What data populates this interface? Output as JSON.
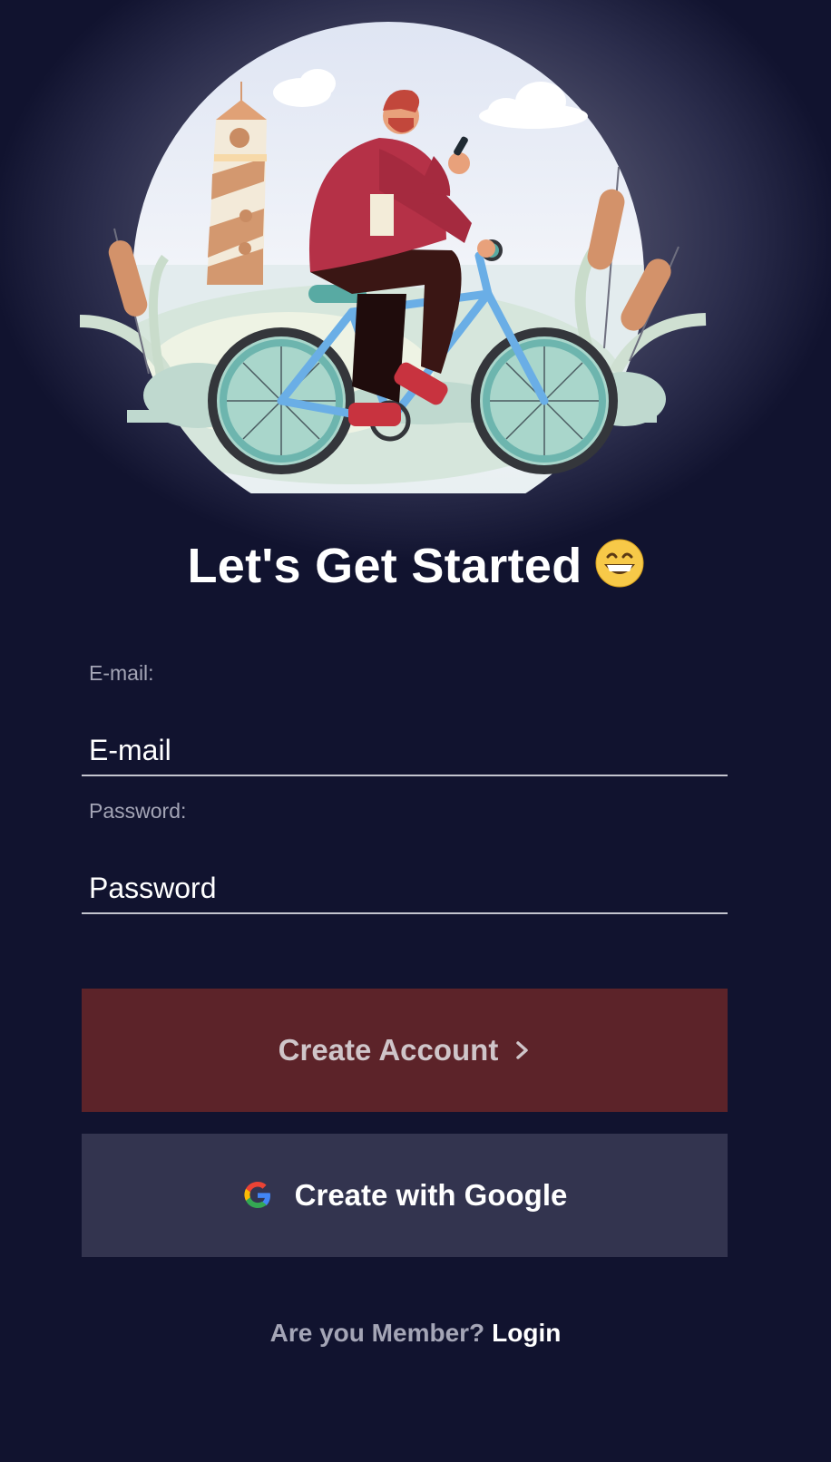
{
  "header": {
    "title": "Let's Get Started",
    "title_emoji": "grinning-face-emoji"
  },
  "form": {
    "email_label": "E-mail:",
    "email_placeholder": "E-mail",
    "email_value": "",
    "password_label": "Password:",
    "password_placeholder": "Password",
    "password_value": ""
  },
  "actions": {
    "create_account_label": "Create Account",
    "create_account_icon": "chevron-right-icon",
    "google_label": "Create with Google",
    "google_icon": "google-icon"
  },
  "footer": {
    "member_prompt": "Are you Member?",
    "login_label": "Login"
  },
  "colors": {
    "background": "#11132f",
    "create_button": "#5c2329",
    "google_button": "#33344f",
    "text_muted": "#a4a5b6"
  }
}
